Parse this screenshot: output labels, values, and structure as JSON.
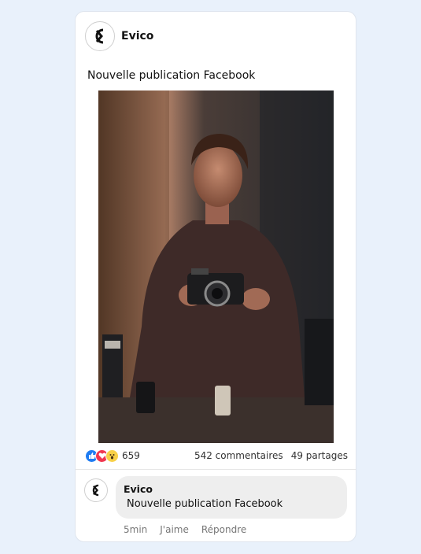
{
  "post": {
    "author": "Evico",
    "text": "Nouvelle publication Facebook",
    "image": "man-holding-camera-photo"
  },
  "stats": {
    "reactions": [
      "like-icon",
      "love-icon",
      "wow-icon"
    ],
    "reaction_count": "659",
    "comments": "542 commentaires",
    "shares": "49 partages"
  },
  "comment": {
    "author": "Evico",
    "text": "Nouvelle publication Facebook",
    "time": "5min",
    "like_label": "J'aime",
    "reply_label": "Répondre"
  },
  "colors": {
    "background": "#e9f1fb",
    "like": "#1f7cf2",
    "love": "#f0364f",
    "wow": "#f8d047",
    "bubble": "#eeeeee"
  }
}
